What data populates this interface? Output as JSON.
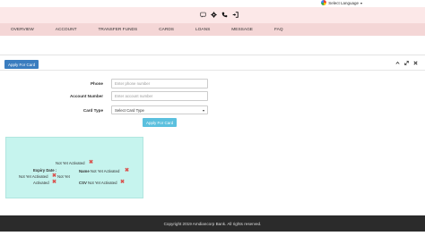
{
  "language": {
    "label": "Select Language"
  },
  "header": {
    "icons": [
      "chat-icon",
      "gear-icon",
      "phone-icon",
      "logout-icon"
    ]
  },
  "nav": {
    "items": [
      "OVERVIEW",
      "ACCOUNT",
      "TRANSFER FUNDS",
      "CARDS",
      "LOANS",
      "MESSAGE",
      "FAQ"
    ]
  },
  "panel": {
    "apply_button": "Apply For Card",
    "tools": [
      "collapse-icon",
      "expand-icon",
      "close-icon"
    ]
  },
  "form": {
    "phone_label": "Phone",
    "phone_placeholder": "Enter phone number",
    "account_label": "Account Number",
    "account_placeholder": "Enter account number",
    "card_type_label": "Card Type",
    "card_type_selected": "Select Card Type",
    "submit_label": "Apply For Card"
  },
  "card": {
    "status_top": "Not Yet Activated",
    "expiry_label": "Expiry Date :",
    "expiry_value_1": "Not Yet Activated",
    "expiry_value_2": "Not Yet",
    "expiry_value_3": "Activated",
    "name_label": "Name",
    "name_value": "Not Yet Activated",
    "cvv_label": "CSV",
    "cvv_value": "Not Yet Activated"
  },
  "footer": {
    "text": "Copyright 2019 Amdiancorp Bank. All rights reserved."
  }
}
